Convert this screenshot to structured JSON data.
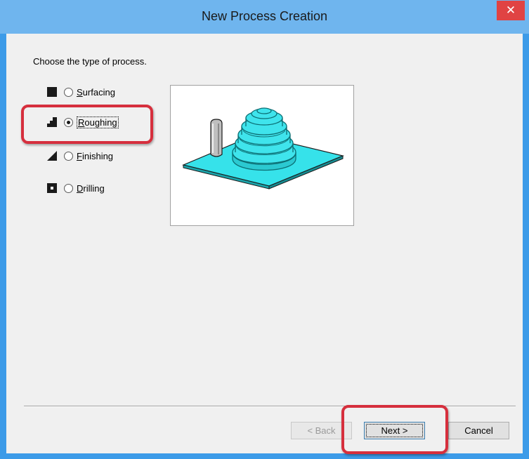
{
  "window": {
    "title": "New Process Creation",
    "close_glyph": "✕"
  },
  "dialog": {
    "prompt": "Choose the type of process.",
    "options": [
      {
        "label": "Surfacing",
        "mnemonic": "S",
        "rest": "urfacing",
        "checked": false,
        "icon": "surfacing-icon"
      },
      {
        "label": "Roughing",
        "mnemonic": "R",
        "rest": "oughing",
        "checked": true,
        "icon": "roughing-icon"
      },
      {
        "label": "Finishing",
        "mnemonic": "F",
        "rest": "inishing",
        "checked": false,
        "icon": "finishing-icon"
      },
      {
        "label": "Drilling",
        "mnemonic": "D",
        "rest": "rilling",
        "checked": false,
        "icon": "drilling-icon"
      }
    ],
    "preview_image": "roughing-preview-illustration"
  },
  "buttons": {
    "back_label": "< Back",
    "back_mnemonic": "B",
    "next_label": "Next >",
    "next_mnemonic": "N",
    "cancel_label": "Cancel"
  },
  "colors": {
    "title_bar": "#6fb5ee",
    "close_button": "#e04343",
    "highlight": "#d62f3d",
    "preview_cyan": "#33e0e8"
  }
}
